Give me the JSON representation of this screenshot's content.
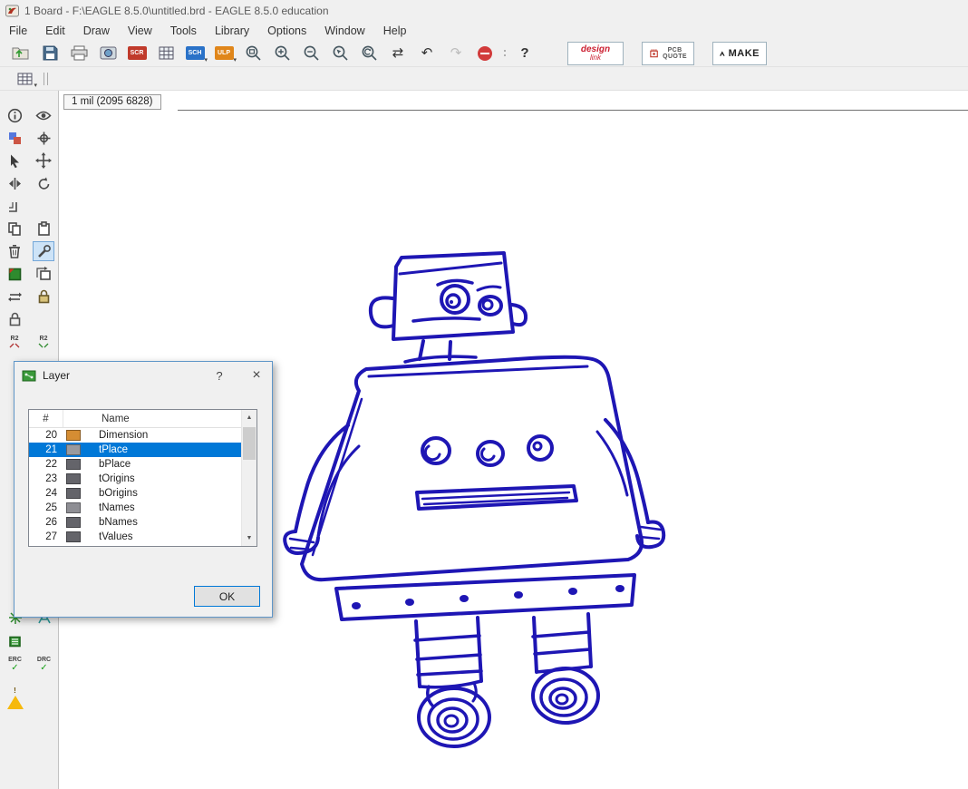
{
  "window": {
    "title": "1 Board - F:\\EAGLE 8.5.0\\untitled.brd - EAGLE 8.5.0 education"
  },
  "menu": {
    "items": [
      "File",
      "Edit",
      "Draw",
      "View",
      "Tools",
      "Library",
      "Options",
      "Window",
      "Help"
    ]
  },
  "toolbar": {
    "scr_label": "SCR",
    "sch_label": "SCH",
    "ulp_label": "ULP",
    "design_link_line1": "design",
    "design_link_line2": "link",
    "pcb_quote_line1": "PCB",
    "pcb_quote_line2": "QUOTE",
    "make_label": "MAKE"
  },
  "icons": {
    "caret": "▾",
    "undo": "↶",
    "redo": "↷",
    "redraw": "⇄",
    "help": "?",
    "scroll_up": "▲",
    "scroll_down": "▼",
    "check": "✓",
    "warning": "!"
  },
  "coordinate_bar": {
    "position": "1 mil (2095 6828)"
  },
  "sidebar": {
    "smash_label": "R2",
    "erc_label": "ERC",
    "drc_label": "DRC"
  },
  "layer_dialog": {
    "title": "Layer",
    "help_label": "?",
    "close_label": "×",
    "columns": {
      "number": "#",
      "name": "Name"
    },
    "selected_layer": "21",
    "rows": [
      {
        "number": "20",
        "name": "Dimension",
        "color": "#d58d33",
        "selected": false
      },
      {
        "number": "21",
        "name": "tPlace",
        "color": "#9a9a9e",
        "selected": true
      },
      {
        "number": "22",
        "name": "bPlace",
        "color": "#64646a",
        "selected": false
      },
      {
        "number": "23",
        "name": "tOrigins",
        "color": "#64646a",
        "selected": false
      },
      {
        "number": "24",
        "name": "bOrigins",
        "color": "#64646a",
        "selected": false
      },
      {
        "number": "25",
        "name": "tNames",
        "color": "#8e8e94",
        "selected": false
      },
      {
        "number": "26",
        "name": "bNames",
        "color": "#64646a",
        "selected": false
      },
      {
        "number": "27",
        "name": "tValues",
        "color": "#64646a",
        "selected": false
      }
    ],
    "ok_label": "OK"
  },
  "canvas": {
    "drawing": "hand-drawn robot sketch",
    "stroke_color": "#1e16b4"
  }
}
